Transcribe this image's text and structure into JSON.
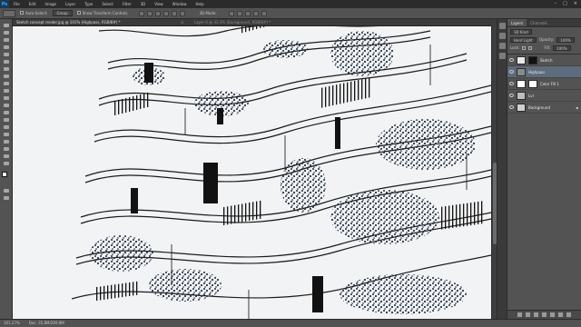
{
  "menu": {
    "logo": "Ps",
    "items": [
      "File",
      "Edit",
      "Image",
      "Layer",
      "Type",
      "Select",
      "Filter",
      "3D",
      "View",
      "Window",
      "Help"
    ]
  },
  "options": {
    "auto_select_label": "Auto-Select:",
    "auto_select_value": "Group",
    "show_transform_label": "Show Transform Controls",
    "mode_3d_label": "3D Mode:"
  },
  "document": {
    "tab_title": "Sketch concept render.jpg @ 101% (Highpass, RGB/8#) *",
    "tab_title_2": "Layer 0 @ 33.3% (Background, RGB/8#) *"
  },
  "status": {
    "zoom": "101.27%",
    "doc_size": "Doc: 35.8M/269.9M"
  },
  "layers_panel": {
    "tabs": [
      "Layers",
      "Channels"
    ],
    "kind_label": "3D Kind",
    "blend_mode": "Hard Light",
    "opacity_label": "Opacity:",
    "opacity_value": "100%",
    "lock_label": "Lock:",
    "fill_label": "Fill:",
    "fill_value": "100%",
    "layers": [
      {
        "name": "Sketch",
        "active": false
      },
      {
        "name": "Highpass",
        "active": true
      },
      {
        "name": "Color Fill 1",
        "active": false
      },
      {
        "name": "Lvl",
        "active": false
      },
      {
        "name": "Background",
        "active": false
      }
    ]
  },
  "toolbar": {
    "tools": [
      "move-tool",
      "marquee-tool",
      "lasso-tool",
      "quick-select-tool",
      "crop-tool",
      "eyedropper-tool",
      "healing-tool",
      "brush-tool",
      "clone-stamp-tool",
      "history-brush-tool",
      "eraser-tool",
      "gradient-tool",
      "blur-tool",
      "dodge-tool",
      "pen-tool",
      "type-tool",
      "path-select-tool",
      "shape-tool",
      "hand-tool",
      "zoom-tool"
    ]
  }
}
